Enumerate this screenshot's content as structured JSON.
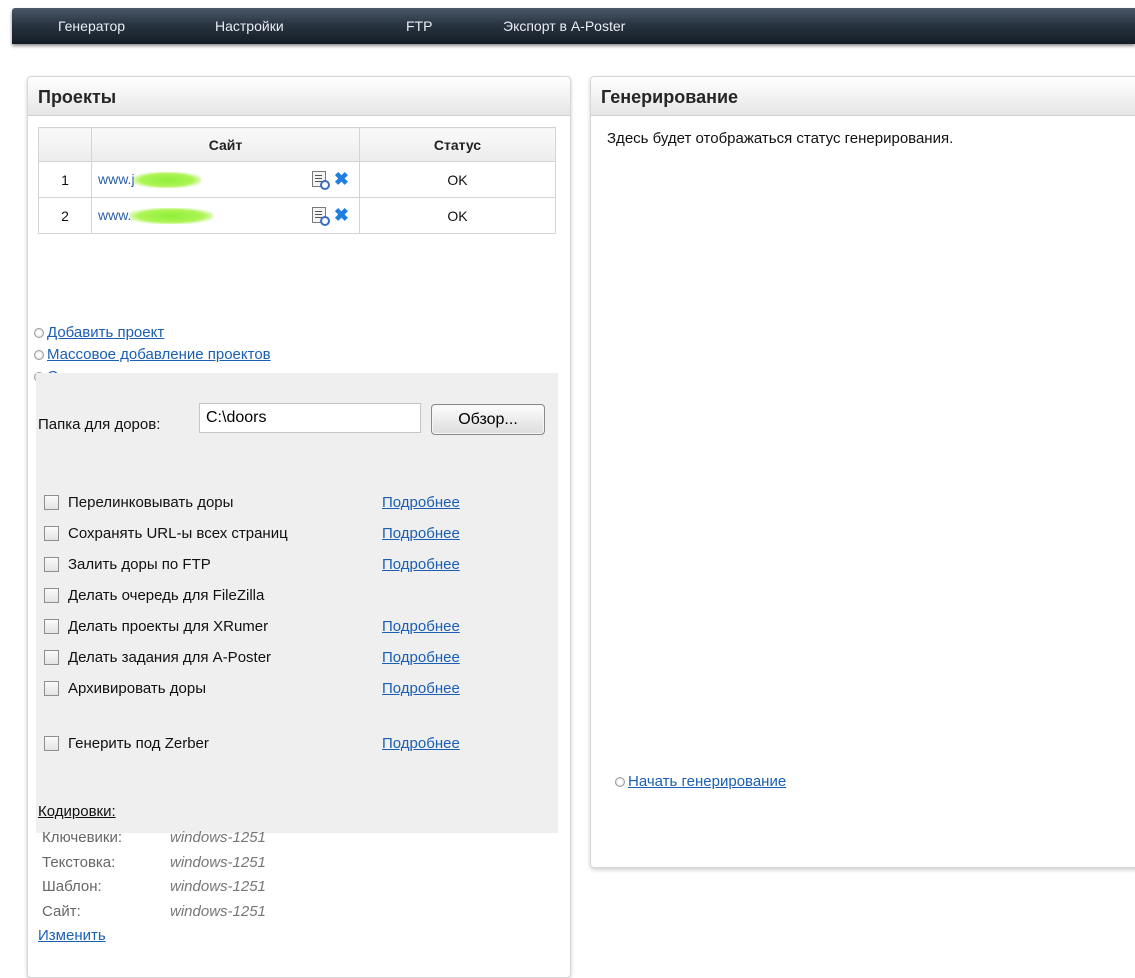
{
  "nav": [
    "Генератор",
    "Настройки",
    "FTP",
    "Экспорт в A-Poster"
  ],
  "projects": {
    "title": "Проекты",
    "table": {
      "headers": [
        "",
        "Сайт",
        "Статус"
      ],
      "rows": [
        {
          "num": "1",
          "site": "www.j",
          "status": "OK"
        },
        {
          "num": "2",
          "site": "www.",
          "status": "OK"
        }
      ]
    },
    "links": [
      "Добавить проект",
      "Массовое добавление проектов",
      "Очистить"
    ],
    "folder_label": "Папка для доров:",
    "folder_value": "C:\\doors",
    "browse_label": "Обзор...",
    "more_label": "Подробнее",
    "options": [
      "Перелинковывать доры",
      "Сохранять URL-ы всех страниц",
      "Залить доры по FTP",
      "Делать очередь для FileZilla",
      "Делать проекты для XRumer",
      "Делать задания для A-Poster",
      "Архивировать доры",
      "Генерить под Zerber"
    ],
    "encodings": {
      "title": "Кодировки:",
      "rows": [
        {
          "label": "Ключевики:",
          "value": "windows-1251"
        },
        {
          "label": "Текстовка:",
          "value": "windows-1251"
        },
        {
          "label": "Шаблон:",
          "value": "windows-1251"
        },
        {
          "label": "Сайт:",
          "value": "windows-1251"
        }
      ],
      "change_label": "Изменить"
    }
  },
  "generation": {
    "title": "Генерирование",
    "status_text": "Здесь будет отображаться статус генерирования.",
    "start_label": "Начать генерирование"
  },
  "colors": {
    "link": "#1a5fb4",
    "nav_bg": "#1e2833",
    "remove_icon": "#1f7ee0",
    "blurred_site": "#8ef03a"
  }
}
